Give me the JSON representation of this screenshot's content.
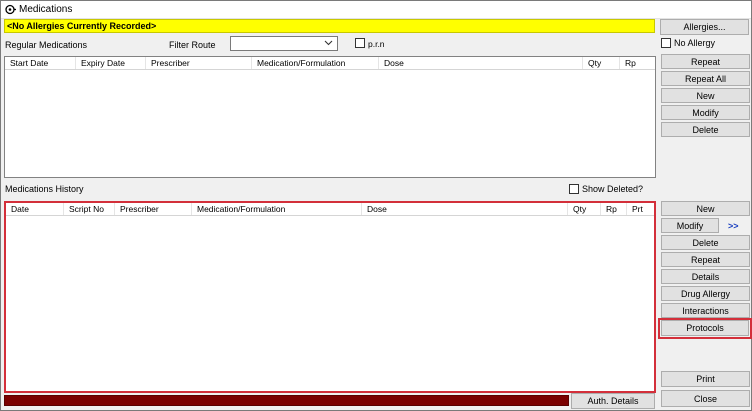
{
  "window": {
    "title": "Medications"
  },
  "allergy_banner": "<No Allergies Currently Recorded>",
  "allergies_button": "Allergies...",
  "no_allergy_label": "No Allergy",
  "regular": {
    "section_label": "Regular Medications",
    "filter_route_label": "Filter Route",
    "filter_route_value": "",
    "prn_label": "p.r.n",
    "columns": [
      "Start Date",
      "Expiry Date",
      "Prescriber",
      "Medication/Formulation",
      "Dose",
      "Qty",
      "Rp"
    ],
    "buttons": {
      "repeat": "Repeat",
      "repeat_all": "Repeat All",
      "new": "New",
      "modify": "Modify",
      "delete": "Delete"
    }
  },
  "history": {
    "section_label": "Medications History",
    "show_deleted_label": "Show Deleted?",
    "columns": [
      "Date",
      "Script No",
      "Prescriber",
      "Medication/Formulation",
      "Dose",
      "Qty",
      "Rp",
      "Prt"
    ],
    "buttons": {
      "new": "New",
      "modify": "Modify",
      "expand": ">>",
      "delete": "Delete",
      "repeat": "Repeat",
      "details": "Details",
      "drug_allergy": "Drug Allergy",
      "interactions": "Interactions",
      "protocols": "Protocols"
    }
  },
  "footer": {
    "auth_details": "Auth. Details",
    "print": "Print",
    "close": "Close"
  },
  "colors": {
    "highlight": "#d32f3a",
    "banner": "#ffff00",
    "status_bar": "#7b0000",
    "link_arrows": "#1a3fbf"
  }
}
